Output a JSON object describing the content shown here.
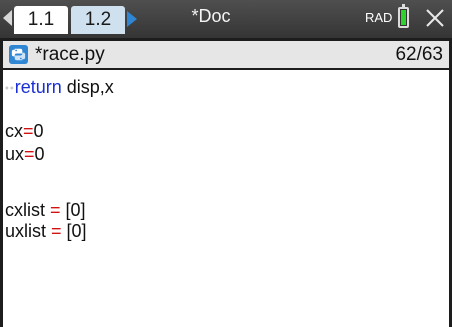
{
  "tabs": [
    {
      "label": "1.1"
    },
    {
      "label": "1.2"
    }
  ],
  "document_title": "*Doc",
  "angle_mode": "RAD",
  "colors": {
    "battery": "#2ed12e",
    "keyword": "#1a2fd6",
    "operator": "#d11212"
  },
  "editor": {
    "file_name": "*race.py",
    "line_position": "62/63",
    "lines": [
      {
        "indent": "••",
        "keyword": "return",
        "text": " disp,x"
      },
      {
        "text": ""
      },
      {
        "name": "cx",
        "op": "=",
        "value": "0"
      },
      {
        "name": "ux",
        "op": "=",
        "value": "0"
      },
      {
        "text": ""
      },
      {
        "name": "cxlist ",
        "op": "=",
        "value": " [0]"
      },
      {
        "name": "uxlist ",
        "op": "=",
        "value": " [0]"
      }
    ]
  },
  "icons": {
    "prev_tab": "left-triangle-icon",
    "next_tab": "right-triangle-icon",
    "battery": "battery-icon",
    "close": "close-icon",
    "python": "python-icon"
  }
}
